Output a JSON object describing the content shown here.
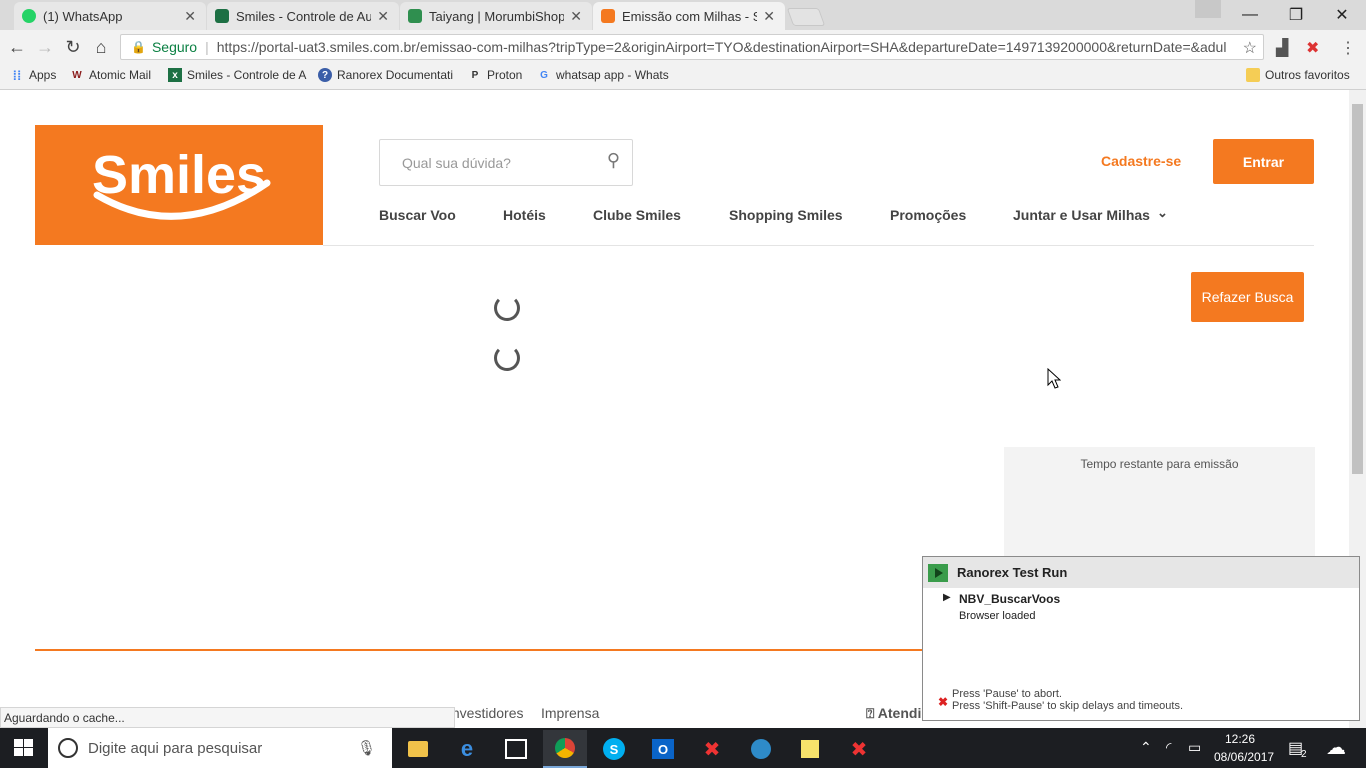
{
  "browser": {
    "tabs": [
      {
        "title": "(1) WhatsApp",
        "icon": "whatsapp-icon",
        "color": "#25d366"
      },
      {
        "title": "Smiles - Controle de Aut",
        "icon": "excel-icon",
        "color": "#1d7044"
      },
      {
        "title": "Taiyang | MorumbiShopp",
        "icon": "sheets-icon",
        "color": "#2f8f4f"
      },
      {
        "title": "Emissão com Milhas - Sm",
        "icon": "smiles-icon",
        "color": "#f47920"
      }
    ],
    "tab_close": "✕",
    "window_controls": {
      "minimize": "—",
      "restore": "❐",
      "close": "✕"
    },
    "secure_label": "Seguro",
    "url": "https://portal-uat3.smiles.com.br/emissao-com-milhas?tripType=2&originAirport=TYO&destinationAirport=SHA&departureDate=1497139200000&returnDate=&adul",
    "bookmarks": [
      {
        "label": "Apps",
        "icon": "apps-grid-icon"
      },
      {
        "label": "Atomic Mail",
        "icon": "atomic-mail-icon"
      },
      {
        "label": "Smiles - Controle de A",
        "icon": "excel-icon"
      },
      {
        "label": "Ranorex Documentati",
        "icon": "ranorex-help-icon"
      },
      {
        "label": "Proton",
        "icon": "proton-icon"
      },
      {
        "label": "whatsap app - Whats",
        "icon": "google-icon"
      },
      {
        "label": "Outros favoritos",
        "icon": "folder-icon"
      }
    ]
  },
  "page": {
    "logo_text": "Smiles",
    "search_placeholder": "Qual sua dúvida?",
    "nav": [
      "Buscar Voo",
      "Hotéis",
      "Clube Smiles",
      "Shopping Smiles",
      "Promoções",
      "Juntar e Usar Milhas"
    ],
    "signup_label": "Cadastre-se",
    "login_label": "Entrar",
    "redo_search_label": "Refazer Busca",
    "timer_label": "Tempo restante para emissão",
    "footer_links": [
      "Investidores",
      "Imprensa",
      "Atendimento"
    ]
  },
  "ranorex": {
    "title": "Ranorex Test Run",
    "test_name": "NBV_BuscarVoos",
    "step": "Browser loaded",
    "hint1": "Press 'Pause' to abort.",
    "hint2": "Press 'Shift-Pause' to skip delays and timeouts."
  },
  "status_bar": "Aguardando o cache...",
  "taskbar": {
    "search_placeholder": "Digite aqui para pesquisar",
    "time": "12:26",
    "date": "08/06/2017",
    "notification_count": "2"
  },
  "colors": {
    "brand": "#f47920",
    "taskbar": "#1c1e22"
  }
}
